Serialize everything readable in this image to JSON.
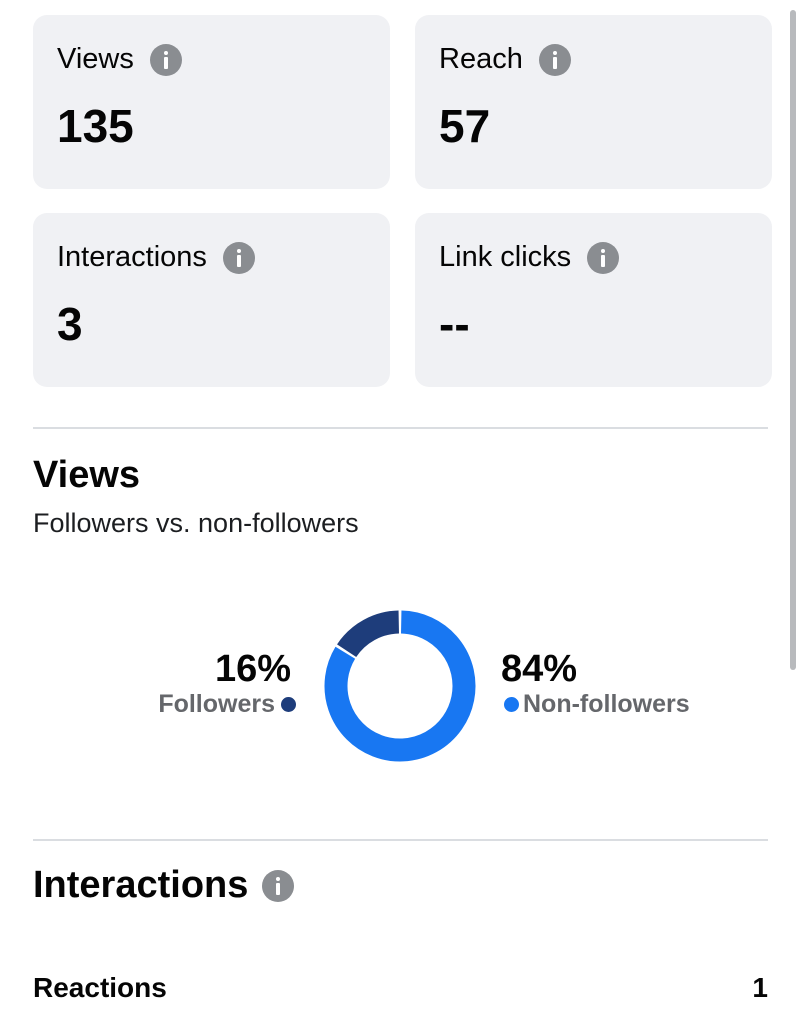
{
  "metrics": [
    {
      "label": "Views",
      "value": "135"
    },
    {
      "label": "Reach",
      "value": "57"
    },
    {
      "label": "Interactions",
      "value": "3"
    },
    {
      "label": "Link clicks",
      "value": "--"
    }
  ],
  "views_section": {
    "title": "Views",
    "subtitle": "Followers vs. non-followers",
    "followers": {
      "percent_label": "16%",
      "label": "Followers",
      "value": 16,
      "color": "#1e3d7b"
    },
    "non_followers": {
      "percent_label": "84%",
      "label": "Non-followers",
      "value": 84,
      "color": "#1877f2"
    }
  },
  "interactions_section": {
    "title": "Interactions",
    "rows": [
      {
        "label": "Reactions",
        "value": "1"
      }
    ]
  },
  "icons": {
    "info": "info-icon"
  },
  "colors": {
    "card_bg": "#f0f1f4",
    "followers": "#1e3d7b",
    "non_followers": "#1877f2"
  }
}
